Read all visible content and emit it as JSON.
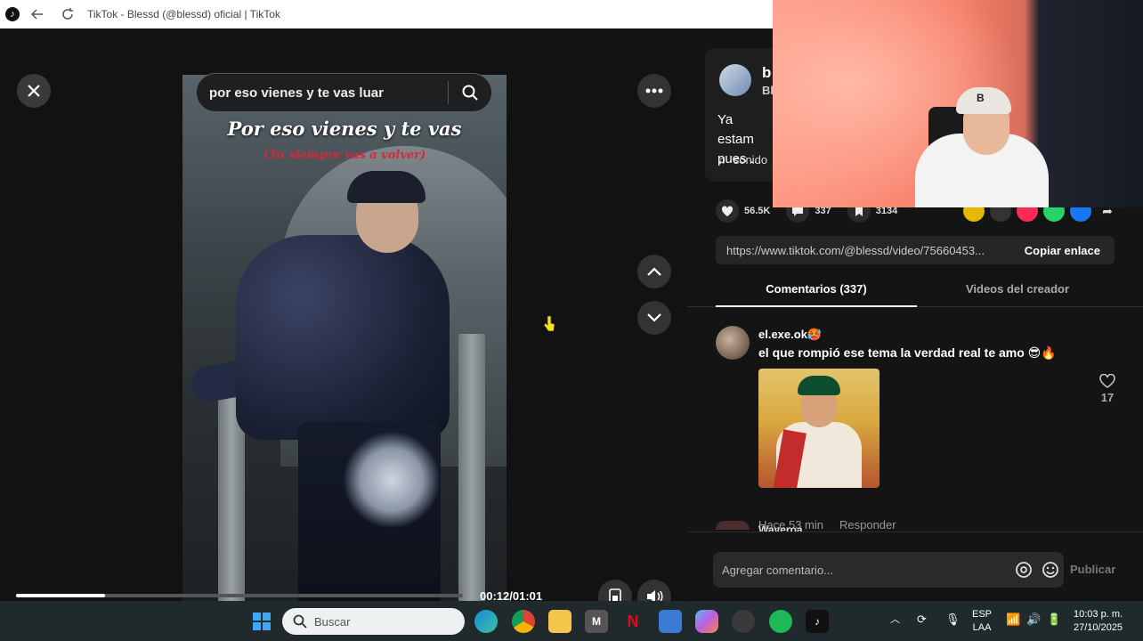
{
  "titlebar": {
    "title": "TikTok - Blessd (@blessd) oficial | TikTok",
    "logo_icon": "tiktok-icon",
    "back_icon": "arrow-left-icon",
    "reload_icon": "reload-icon"
  },
  "video": {
    "search_text": "por eso vienes y te vas luar",
    "title_line": "Por eso vienes y te vas",
    "subtitle_line": "(Tu siempre vas a volver)",
    "time": "00:12/01:01",
    "progress": 0.2
  },
  "author": {
    "handle": "b",
    "name": "Bl",
    "description": "Ya estam\npues ...",
    "music": "sonido"
  },
  "actions": {
    "likes": "56.5K",
    "comments": "337",
    "saves": "3134"
  },
  "share": {
    "url": "https://www.tiktok.com/@blessd/video/75660453...",
    "copy_label": "Copiar enlace"
  },
  "tabs": {
    "comments": "Comentarios (337)",
    "creator_videos": "Videos del creador"
  },
  "comment": {
    "user": "el.exe.ok🥵",
    "text": "el que rompió ese tema la verdad real te amo 😎🔥",
    "time": "Hace 53 min",
    "reply": "Responder",
    "likes": "17"
  },
  "next_comment_user": "Waveroa",
  "composer": {
    "placeholder": "Agregar comentario...",
    "publish": "Publicar"
  },
  "taskbar": {
    "search_label": "Buscar",
    "lang_top": "ESP",
    "lang_bottom": "LAA",
    "time": "10:03 p. m.",
    "date": "27/10/2025"
  },
  "webcam": {
    "cap_letter": "B"
  },
  "colors": {
    "accent_red": "#d9263a",
    "panel_bg": "#141414",
    "taskbar_bg": "#202a2c"
  }
}
